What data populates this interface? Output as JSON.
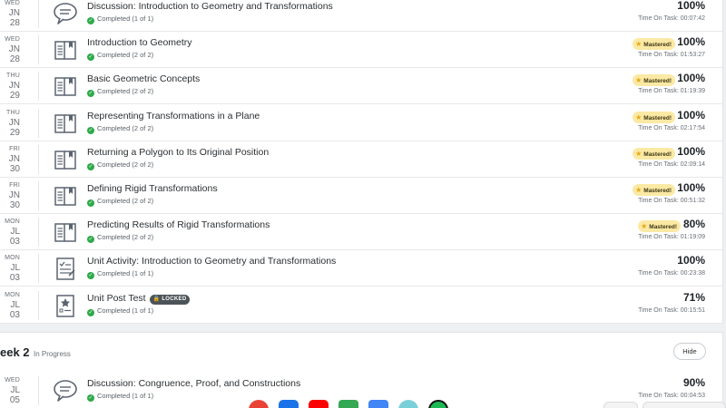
{
  "activities": [
    {
      "dow": "WED",
      "day": "JN 28",
      "icon": "discussion-icon",
      "title": "Discussion: Introduction to Geometry and Transformations",
      "status": "Completed (1 of 1)",
      "mastered": false,
      "percent": "100%",
      "time": "Time On Task: 00:07:42"
    },
    {
      "dow": "WED",
      "day": "JN 28",
      "icon": "lesson-book-icon",
      "title": "Introduction to Geometry",
      "status": "Completed (2 of 2)",
      "mastered": true,
      "percent": "100%",
      "time": "Time On Task: 01:53:27"
    },
    {
      "dow": "THU",
      "day": "JN 29",
      "icon": "lesson-book-icon",
      "title": "Basic Geometric Concepts",
      "status": "Completed (2 of 2)",
      "mastered": true,
      "percent": "100%",
      "time": "Time On Task: 01:19:39"
    },
    {
      "dow": "THU",
      "day": "JN 29",
      "icon": "lesson-book-icon",
      "title": "Representing Transformations in a Plane",
      "status": "Completed (2 of 2)",
      "mastered": true,
      "percent": "100%",
      "time": "Time On Task: 02:17:54"
    },
    {
      "dow": "FRI",
      "day": "JN 30",
      "icon": "lesson-book-icon",
      "title": "Returning a Polygon to Its Original Position",
      "status": "Completed (2 of 2)",
      "mastered": true,
      "percent": "100%",
      "time": "Time On Task: 02:09:14"
    },
    {
      "dow": "FRI",
      "day": "JN 30",
      "icon": "lesson-book-icon",
      "title": "Defining Rigid Transformations",
      "status": "Completed (2 of 2)",
      "mastered": true,
      "percent": "100%",
      "time": "Time On Task: 00:51:32"
    },
    {
      "dow": "MON",
      "day": "JL 03",
      "icon": "lesson-book-icon",
      "title": "Predicting Results of Rigid Transformations",
      "status": "Completed (2 of 2)",
      "mastered": true,
      "percent": "80%",
      "time": "Time On Task: 01:19:09"
    },
    {
      "dow": "MON",
      "day": "JL 03",
      "icon": "unit-activity-icon",
      "title": "Unit Activity: Introduction to Geometry and Transformations",
      "status": "Completed (1 of 1)",
      "mastered": false,
      "percent": "100%",
      "time": "Time On Task: 00:23:38"
    },
    {
      "dow": "MON",
      "day": "JL 03",
      "icon": "post-test-icon",
      "title": "Unit Post Test",
      "locked": "LOCKED",
      "status": "Completed (1 of 1)",
      "mastered": false,
      "percent": "71%",
      "time": "Time On Task: 00:15:51"
    }
  ],
  "mastered_label": "Mastered!",
  "week2": {
    "title": "eek 2",
    "status": "In Progress",
    "hide_label": "Hide",
    "first": {
      "dow": "WED",
      "day": "JL 05",
      "title": "Discussion: Congruence, Proof, and Constructions",
      "status": "Completed (1 of 1)",
      "percent": "90%",
      "time": "Time On Task: 00:04:53"
    }
  },
  "colors": {
    "accent_green": "#2eaa4a",
    "mastered_bg": "#fbe9a4",
    "star": "#e6a817"
  }
}
